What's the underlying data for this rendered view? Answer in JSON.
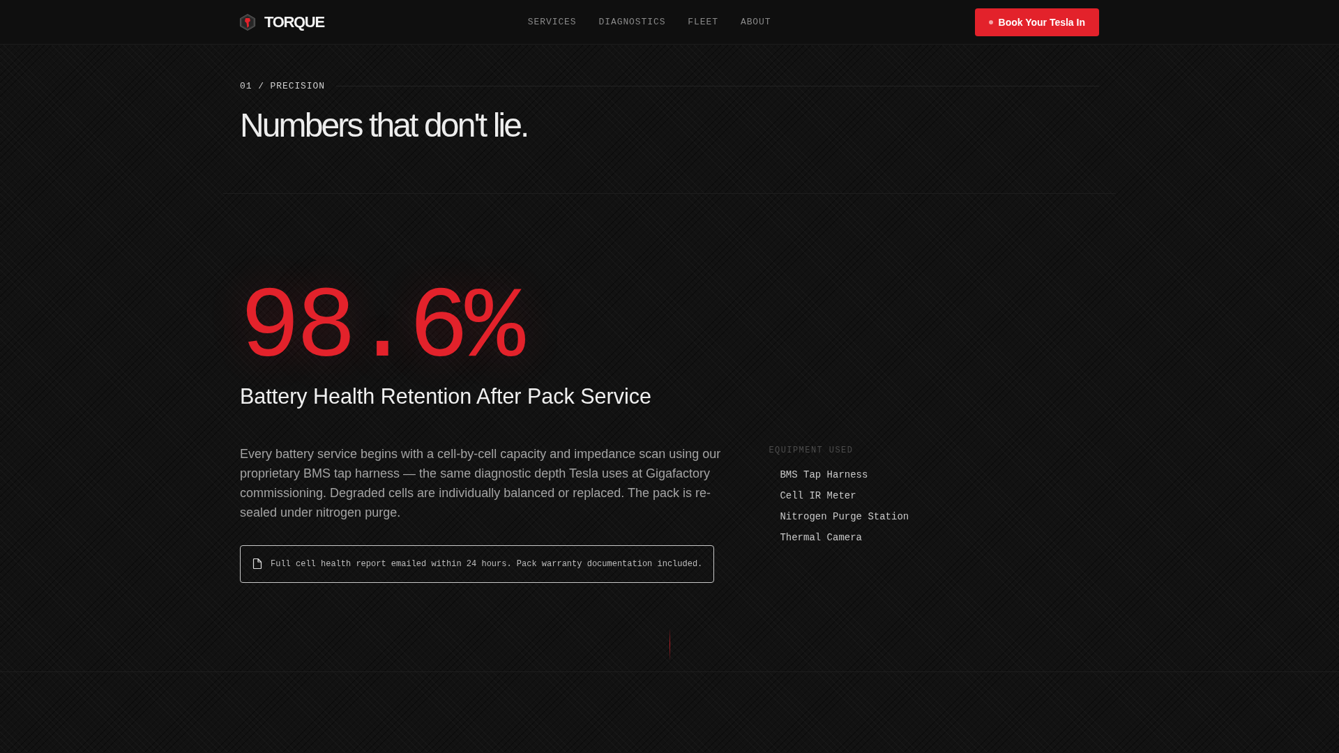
{
  "header": {
    "brand": "TORQUE",
    "nav": [
      "SERVICES",
      "DIAGNOSTICS",
      "FLEET",
      "ABOUT"
    ],
    "cta": "Book Your Tesla In"
  },
  "intro": {
    "eyebrow": "01 / PRECISION",
    "title": "Numbers that don't lie."
  },
  "stat": {
    "value": "98.6%",
    "label": "Battery Health Retention After Pack Service",
    "description": "Every battery service begins with a cell-by-cell capacity and impedance scan using our proprietary BMS tap harness — the same diagnostic depth Tesla uses at Gigafactory commissioning. Degraded cells are individually balanced or replaced. The pack is re-sealed under nitrogen purge.",
    "note": "Full cell health report emailed within 24 hours. Pack warranty documentation included.",
    "equipment": {
      "title": "EQUIPMENT USED",
      "items": [
        "BMS Tap Harness",
        "Cell IR Meter",
        "Nitrogen Purge Station",
        "Thermal Camera"
      ]
    }
  }
}
